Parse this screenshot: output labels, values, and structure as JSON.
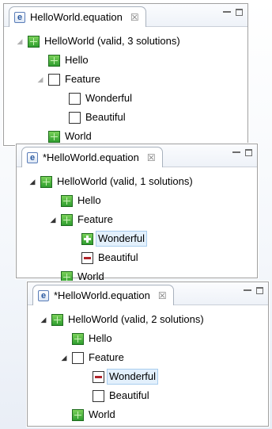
{
  "panels": [
    {
      "tab_title": "HelloWorld.equation",
      "close_glyph": "☒",
      "rows": [
        {
          "indent": 0,
          "expander": "◢",
          "state": "green",
          "label": "HelloWorld (valid, 3 solutions)"
        },
        {
          "indent": 1,
          "expander": "",
          "state": "green",
          "label": "Hello"
        },
        {
          "indent": 1,
          "expander": "◢",
          "state": "empty",
          "label": "Feature"
        },
        {
          "indent": 2,
          "expander": "",
          "state": "empty",
          "label": "Wonderful"
        },
        {
          "indent": 2,
          "expander": "",
          "state": "empty",
          "label": "Beautiful"
        },
        {
          "indent": 1,
          "expander": "",
          "state": "green",
          "label": "World"
        }
      ]
    },
    {
      "tab_title": "*HelloWorld.equation",
      "close_glyph": "☒",
      "rows": [
        {
          "indent": 0,
          "expander": "◢",
          "state": "green",
          "label": "HelloWorld (valid, 1 solutions)"
        },
        {
          "indent": 1,
          "expander": "",
          "state": "green",
          "label": "Hello"
        },
        {
          "indent": 1,
          "expander": "◢",
          "state": "green",
          "label": "Feature"
        },
        {
          "indent": 2,
          "expander": "",
          "state": "plus",
          "label": "Wonderful",
          "selected": true
        },
        {
          "indent": 2,
          "expander": "",
          "state": "red",
          "label": "Beautiful"
        },
        {
          "indent": 1,
          "expander": "",
          "state": "green",
          "label": "World"
        }
      ]
    },
    {
      "tab_title": "*HelloWorld.equation",
      "close_glyph": "☒",
      "rows": [
        {
          "indent": 0,
          "expander": "◢",
          "state": "green",
          "label": "HelloWorld (valid, 2 solutions)"
        },
        {
          "indent": 1,
          "expander": "",
          "state": "green",
          "label": "Hello"
        },
        {
          "indent": 1,
          "expander": "◢",
          "state": "empty",
          "label": "Feature"
        },
        {
          "indent": 2,
          "expander": "",
          "state": "red",
          "label": "Wonderful",
          "selected": true
        },
        {
          "indent": 2,
          "expander": "",
          "state": "empty",
          "label": "Beautiful"
        },
        {
          "indent": 1,
          "expander": "",
          "state": "green",
          "label": "World"
        }
      ]
    }
  ]
}
